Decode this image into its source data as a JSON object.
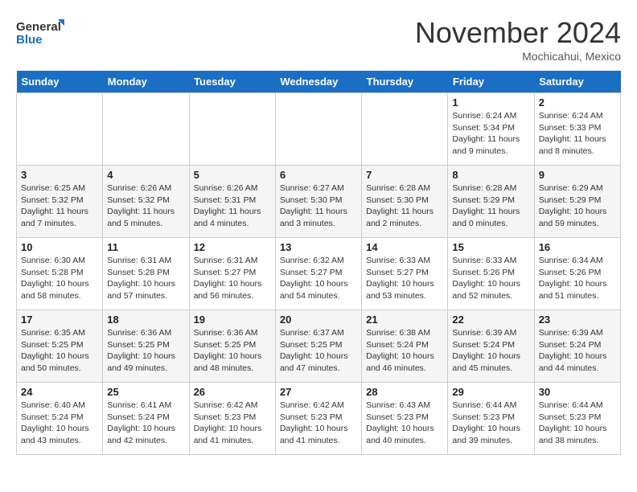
{
  "logo": {
    "line1": "General",
    "line2": "Blue"
  },
  "title": "November 2024",
  "location": "Mochicahui, Mexico",
  "weekdays": [
    "Sunday",
    "Monday",
    "Tuesday",
    "Wednesday",
    "Thursday",
    "Friday",
    "Saturday"
  ],
  "weeks": [
    [
      {
        "day": "",
        "info": ""
      },
      {
        "day": "",
        "info": ""
      },
      {
        "day": "",
        "info": ""
      },
      {
        "day": "",
        "info": ""
      },
      {
        "day": "",
        "info": ""
      },
      {
        "day": "1",
        "info": "Sunrise: 6:24 AM\nSunset: 5:34 PM\nDaylight: 11 hours and 9 minutes."
      },
      {
        "day": "2",
        "info": "Sunrise: 6:24 AM\nSunset: 5:33 PM\nDaylight: 11 hours and 8 minutes."
      }
    ],
    [
      {
        "day": "3",
        "info": "Sunrise: 6:25 AM\nSunset: 5:32 PM\nDaylight: 11 hours and 7 minutes."
      },
      {
        "day": "4",
        "info": "Sunrise: 6:26 AM\nSunset: 5:32 PM\nDaylight: 11 hours and 5 minutes."
      },
      {
        "day": "5",
        "info": "Sunrise: 6:26 AM\nSunset: 5:31 PM\nDaylight: 11 hours and 4 minutes."
      },
      {
        "day": "6",
        "info": "Sunrise: 6:27 AM\nSunset: 5:30 PM\nDaylight: 11 hours and 3 minutes."
      },
      {
        "day": "7",
        "info": "Sunrise: 6:28 AM\nSunset: 5:30 PM\nDaylight: 11 hours and 2 minutes."
      },
      {
        "day": "8",
        "info": "Sunrise: 6:28 AM\nSunset: 5:29 PM\nDaylight: 11 hours and 0 minutes."
      },
      {
        "day": "9",
        "info": "Sunrise: 6:29 AM\nSunset: 5:29 PM\nDaylight: 10 hours and 59 minutes."
      }
    ],
    [
      {
        "day": "10",
        "info": "Sunrise: 6:30 AM\nSunset: 5:28 PM\nDaylight: 10 hours and 58 minutes."
      },
      {
        "day": "11",
        "info": "Sunrise: 6:31 AM\nSunset: 5:28 PM\nDaylight: 10 hours and 57 minutes."
      },
      {
        "day": "12",
        "info": "Sunrise: 6:31 AM\nSunset: 5:27 PM\nDaylight: 10 hours and 56 minutes."
      },
      {
        "day": "13",
        "info": "Sunrise: 6:32 AM\nSunset: 5:27 PM\nDaylight: 10 hours and 54 minutes."
      },
      {
        "day": "14",
        "info": "Sunrise: 6:33 AM\nSunset: 5:27 PM\nDaylight: 10 hours and 53 minutes."
      },
      {
        "day": "15",
        "info": "Sunrise: 6:33 AM\nSunset: 5:26 PM\nDaylight: 10 hours and 52 minutes."
      },
      {
        "day": "16",
        "info": "Sunrise: 6:34 AM\nSunset: 5:26 PM\nDaylight: 10 hours and 51 minutes."
      }
    ],
    [
      {
        "day": "17",
        "info": "Sunrise: 6:35 AM\nSunset: 5:25 PM\nDaylight: 10 hours and 50 minutes."
      },
      {
        "day": "18",
        "info": "Sunrise: 6:36 AM\nSunset: 5:25 PM\nDaylight: 10 hours and 49 minutes."
      },
      {
        "day": "19",
        "info": "Sunrise: 6:36 AM\nSunset: 5:25 PM\nDaylight: 10 hours and 48 minutes."
      },
      {
        "day": "20",
        "info": "Sunrise: 6:37 AM\nSunset: 5:25 PM\nDaylight: 10 hours and 47 minutes."
      },
      {
        "day": "21",
        "info": "Sunrise: 6:38 AM\nSunset: 5:24 PM\nDaylight: 10 hours and 46 minutes."
      },
      {
        "day": "22",
        "info": "Sunrise: 6:39 AM\nSunset: 5:24 PM\nDaylight: 10 hours and 45 minutes."
      },
      {
        "day": "23",
        "info": "Sunrise: 6:39 AM\nSunset: 5:24 PM\nDaylight: 10 hours and 44 minutes."
      }
    ],
    [
      {
        "day": "24",
        "info": "Sunrise: 6:40 AM\nSunset: 5:24 PM\nDaylight: 10 hours and 43 minutes."
      },
      {
        "day": "25",
        "info": "Sunrise: 6:41 AM\nSunset: 5:24 PM\nDaylight: 10 hours and 42 minutes."
      },
      {
        "day": "26",
        "info": "Sunrise: 6:42 AM\nSunset: 5:23 PM\nDaylight: 10 hours and 41 minutes."
      },
      {
        "day": "27",
        "info": "Sunrise: 6:42 AM\nSunset: 5:23 PM\nDaylight: 10 hours and 41 minutes."
      },
      {
        "day": "28",
        "info": "Sunrise: 6:43 AM\nSunset: 5:23 PM\nDaylight: 10 hours and 40 minutes."
      },
      {
        "day": "29",
        "info": "Sunrise: 6:44 AM\nSunset: 5:23 PM\nDaylight: 10 hours and 39 minutes."
      },
      {
        "day": "30",
        "info": "Sunrise: 6:44 AM\nSunset: 5:23 PM\nDaylight: 10 hours and 38 minutes."
      }
    ]
  ]
}
